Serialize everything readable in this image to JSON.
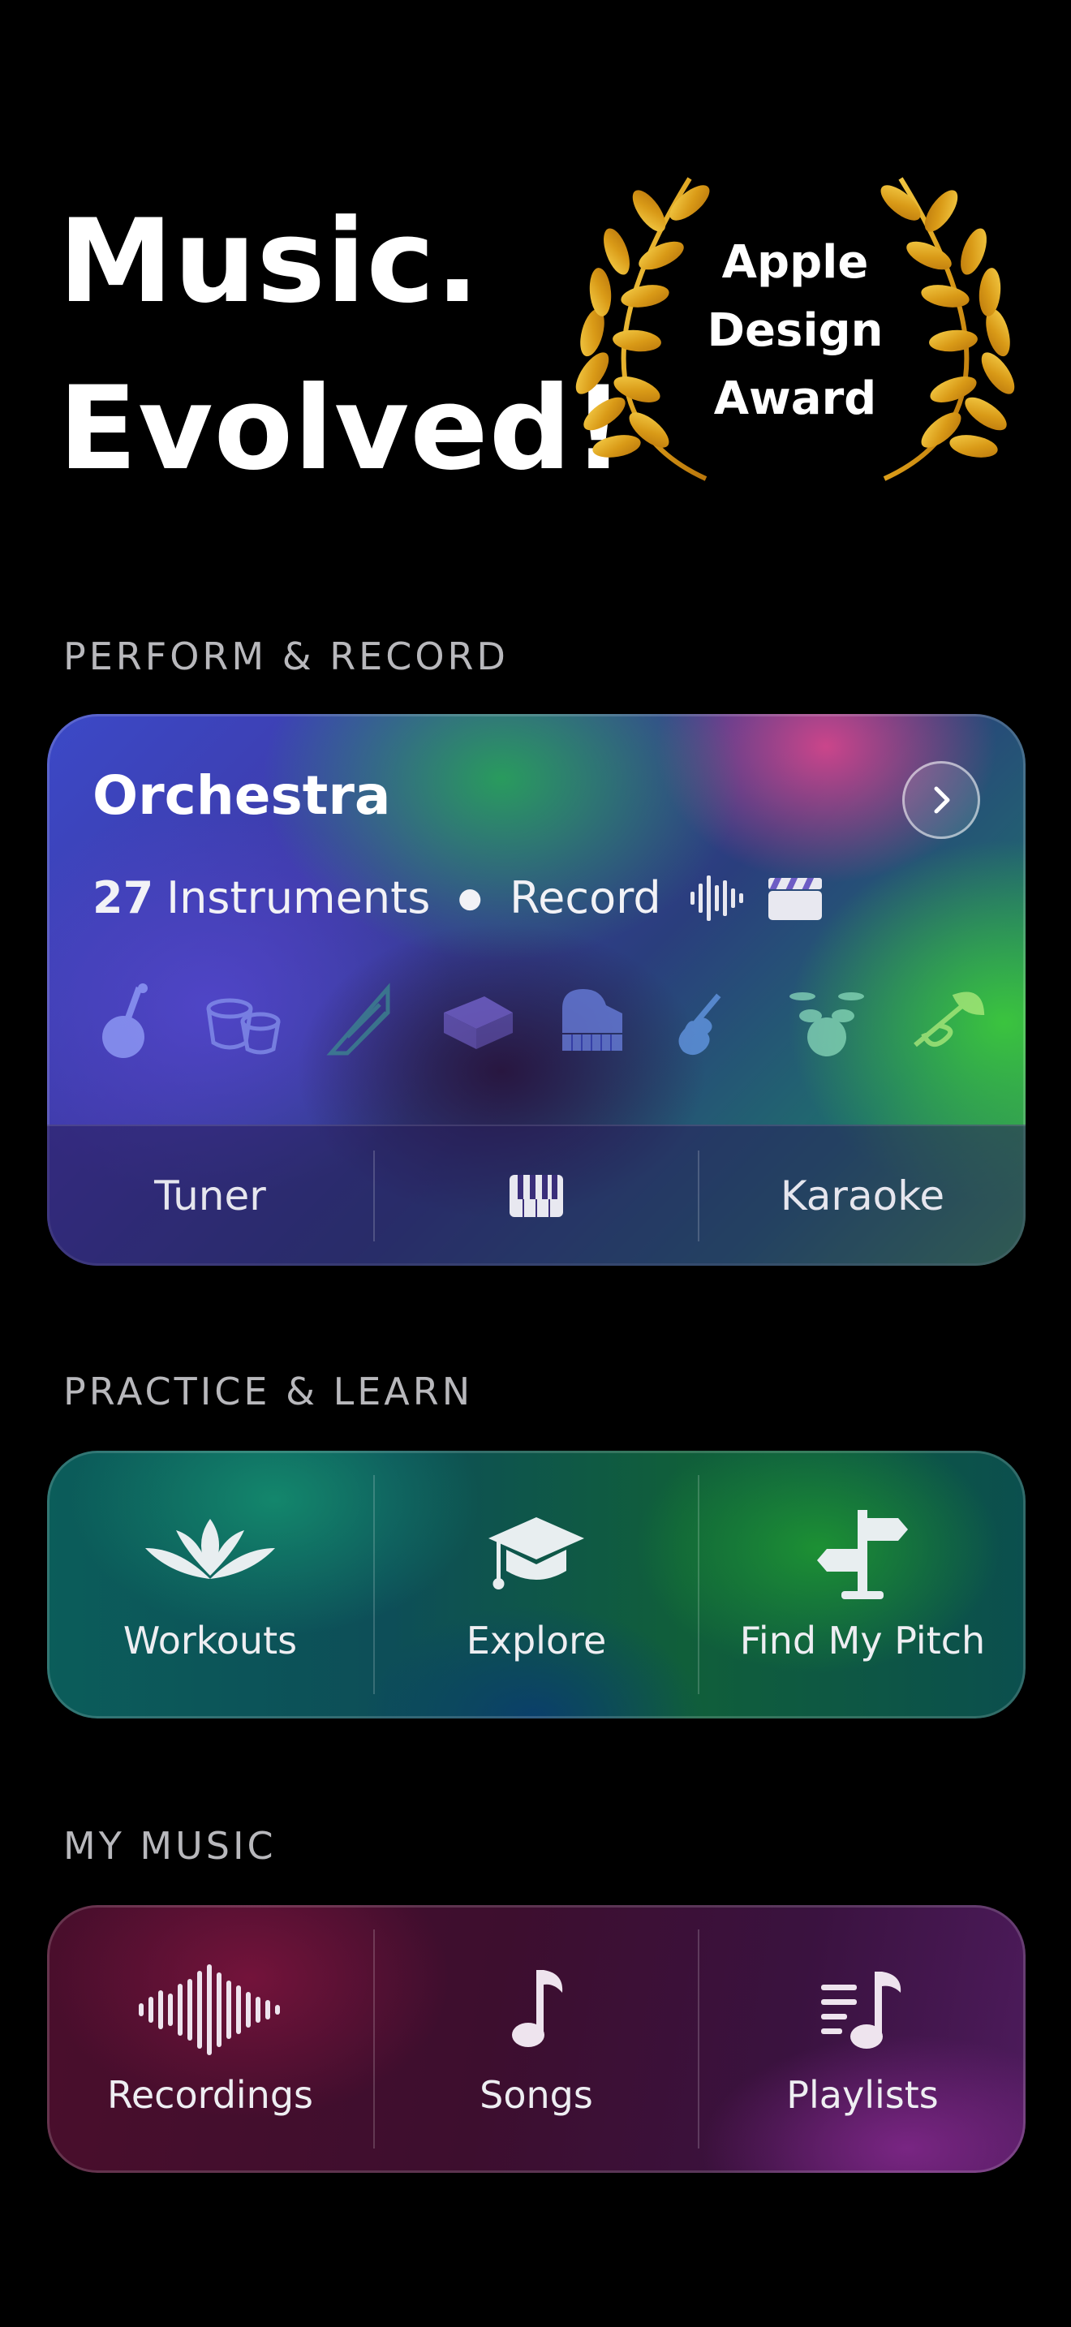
{
  "hero": {
    "line1": "Music.",
    "line2": "Evolved!",
    "award_line1": "Apple",
    "award_line2": "Design",
    "award_line3": "Award"
  },
  "sections": {
    "perform": "PERFORM & RECORD",
    "practice": "PRACTICE & LEARN",
    "my_music": "MY MUSIC"
  },
  "orchestra": {
    "title": "Orchestra",
    "instrument_count": "27",
    "instruments_label": "Instruments",
    "record_label": "Record",
    "instrument_icons": [
      "sitar-icon",
      "tabla-icon",
      "harp-icon",
      "harmonium-icon",
      "piano-icon",
      "violin-icon",
      "drums-icon",
      "trumpet-icon"
    ],
    "bottom": {
      "tuner": "Tuner",
      "karaoke": "Karaoke"
    }
  },
  "practice": {
    "items": [
      {
        "label": "Workouts",
        "icon": "lotus-icon"
      },
      {
        "label": "Explore",
        "icon": "graduation-cap-icon"
      },
      {
        "label": "Find My Pitch",
        "icon": "signpost-icon"
      }
    ]
  },
  "my_music": {
    "items": [
      {
        "label": "Recordings",
        "icon": "waveform-icon"
      },
      {
        "label": "Songs",
        "icon": "music-note-icon"
      },
      {
        "label": "Playlists",
        "icon": "playlist-icon"
      }
    ]
  },
  "colors": {
    "background": "#000000",
    "laurel_gold": "#e0a91e",
    "section_label": "#b8b8bc"
  }
}
